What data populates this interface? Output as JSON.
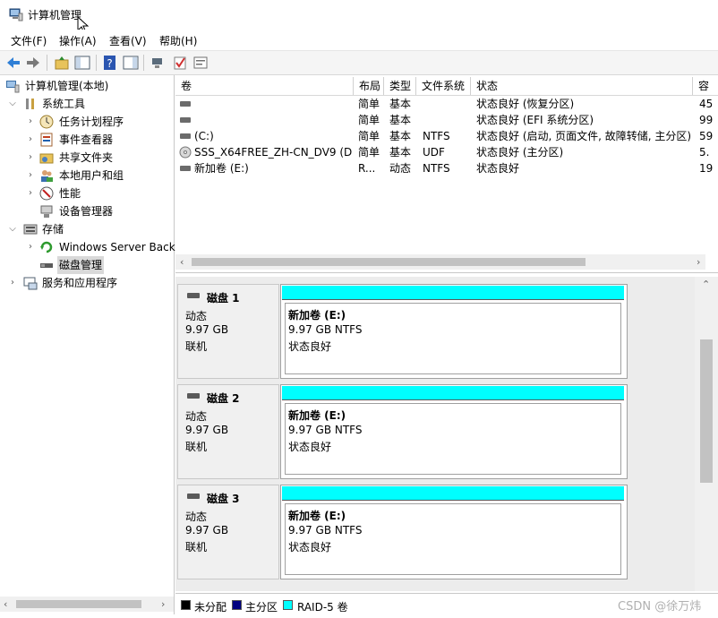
{
  "window": {
    "title": "计算机管理"
  },
  "menu": [
    "文件(F)",
    "操作(A)",
    "查看(V)",
    "帮助(H)"
  ],
  "tree": {
    "root": "计算机管理(本地)",
    "system_tools": "系统工具",
    "task_scheduler": "任务计划程序",
    "event_viewer": "事件查看器",
    "shared_folders": "共享文件夹",
    "local_users": "本地用户和组",
    "performance": "性能",
    "device_manager": "设备管理器",
    "storage": "存储",
    "windows_backup": "Windows Server Back",
    "disk_management": "磁盘管理",
    "services_apps": "服务和应用程序"
  },
  "volume_list": {
    "headers": [
      "卷",
      "布局",
      "类型",
      "文件系统",
      "状态",
      "容"
    ],
    "rows": [
      {
        "volume": "",
        "layout": "简单",
        "type": "基本",
        "fs": "",
        "status": "状态良好 (恢复分区)",
        "cap": "45"
      },
      {
        "volume": "",
        "layout": "简单",
        "type": "基本",
        "fs": "",
        "status": "状态良好 (EFI 系统分区)",
        "cap": "99"
      },
      {
        "volume": "(C:)",
        "layout": "简单",
        "type": "基本",
        "fs": "NTFS",
        "status": "状态良好 (启动, 页面文件, 故障转储, 主分区)",
        "cap": "59"
      },
      {
        "volume": "SSS_X64FREE_ZH-CN_DV9 (D:)",
        "layout": "简单",
        "type": "基本",
        "fs": "UDF",
        "status": "状态良好 (主分区)",
        "cap": "5."
      },
      {
        "volume": "新加卷 (E:)",
        "layout": "R...",
        "type": "动态",
        "fs": "NTFS",
        "status": "状态良好",
        "cap": "19"
      }
    ]
  },
  "disks": [
    {
      "name": "磁盘 1",
      "kind": "动态",
      "size": "9.97 GB",
      "state": "联机",
      "part_name": "新加卷  (E:)",
      "part_size": "9.97 GB NTFS",
      "part_status": "状态良好"
    },
    {
      "name": "磁盘 2",
      "kind": "动态",
      "size": "9.97 GB",
      "state": "联机",
      "part_name": "新加卷  (E:)",
      "part_size": "9.97 GB NTFS",
      "part_status": "状态良好"
    },
    {
      "name": "磁盘 3",
      "kind": "动态",
      "size": "9.97 GB",
      "state": "联机",
      "part_name": "新加卷  (E:)",
      "part_size": "9.97 GB NTFS",
      "part_status": "状态良好"
    }
  ],
  "legend": {
    "unallocated": "未分配",
    "unallocated_color": "#000000",
    "primary": "主分区",
    "primary_color": "#000080",
    "raid5": "RAID-5 卷",
    "raid5_color": "#00ffff"
  },
  "watermark": "CSDN @徐万炜",
  "accent_color": "#00ffff"
}
